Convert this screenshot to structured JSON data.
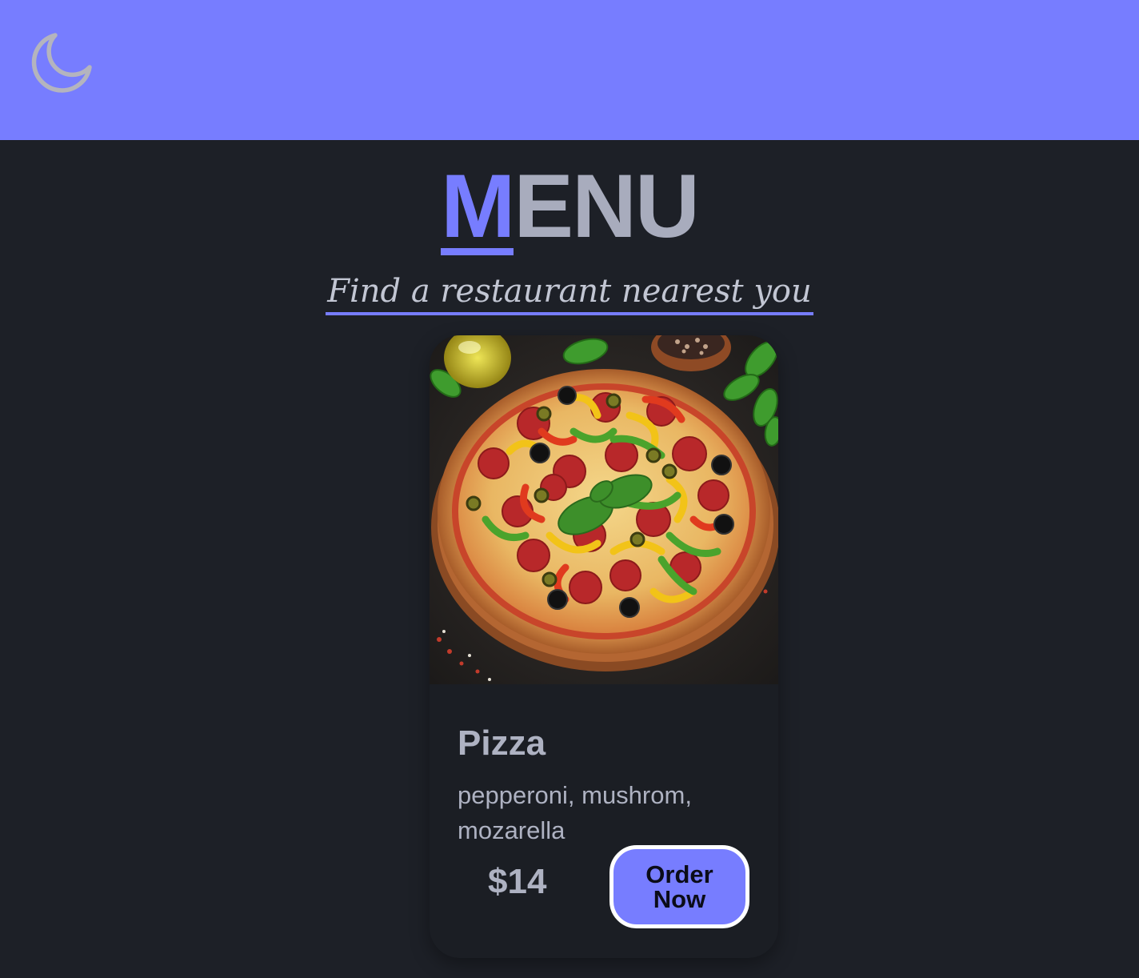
{
  "header": {
    "theme_toggle_icon": "moon-icon",
    "background": "#777dff"
  },
  "page": {
    "title_first_letter": "M",
    "title_rest": "ENU",
    "subtitle": "Find a restaurant nearest you",
    "accent_color": "#777dff"
  },
  "card": {
    "image_alt": "pizza-image",
    "title": "Pizza",
    "description": "pepperoni, mushrom, mozarella",
    "price": "$14",
    "order_label": "Order Now"
  }
}
